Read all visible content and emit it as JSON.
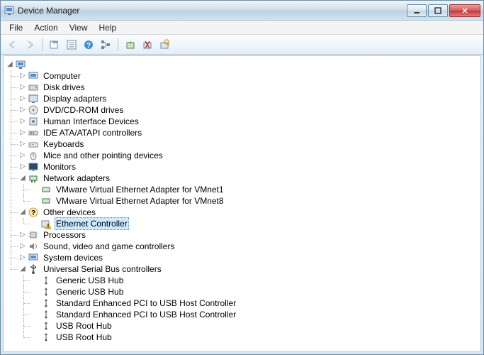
{
  "window": {
    "title": "Device Manager"
  },
  "menus": {
    "file": "File",
    "action": "Action",
    "view": "View",
    "help": "Help"
  },
  "tree": {
    "root": {
      "label": ""
    },
    "computer": "Computer",
    "disk_drives": "Disk drives",
    "display_adapters": "Display adapters",
    "dvd": "DVD/CD-ROM drives",
    "hid": "Human Interface Devices",
    "ide": "IDE ATA/ATAPI controllers",
    "keyboards": "Keyboards",
    "mice": "Mice and other pointing devices",
    "monitors": "Monitors",
    "network": "Network adapters",
    "nic1": "VMware Virtual Ethernet Adapter for VMnet1",
    "nic8": "VMware Virtual Ethernet Adapter for VMnet8",
    "other": "Other devices",
    "ethernet_ctrl": "Ethernet Controller",
    "processors": "Processors",
    "sound": "Sound, video and game controllers",
    "system": "System devices",
    "usb": "Universal Serial Bus controllers",
    "usb_hub1": "Generic USB Hub",
    "usb_hub2": "Generic USB Hub",
    "usb_enh1": "Standard Enhanced PCI to USB Host Controller",
    "usb_enh2": "Standard Enhanced PCI to USB Host Controller",
    "usb_root1": "USB Root Hub",
    "usb_root2": "USB Root Hub"
  }
}
